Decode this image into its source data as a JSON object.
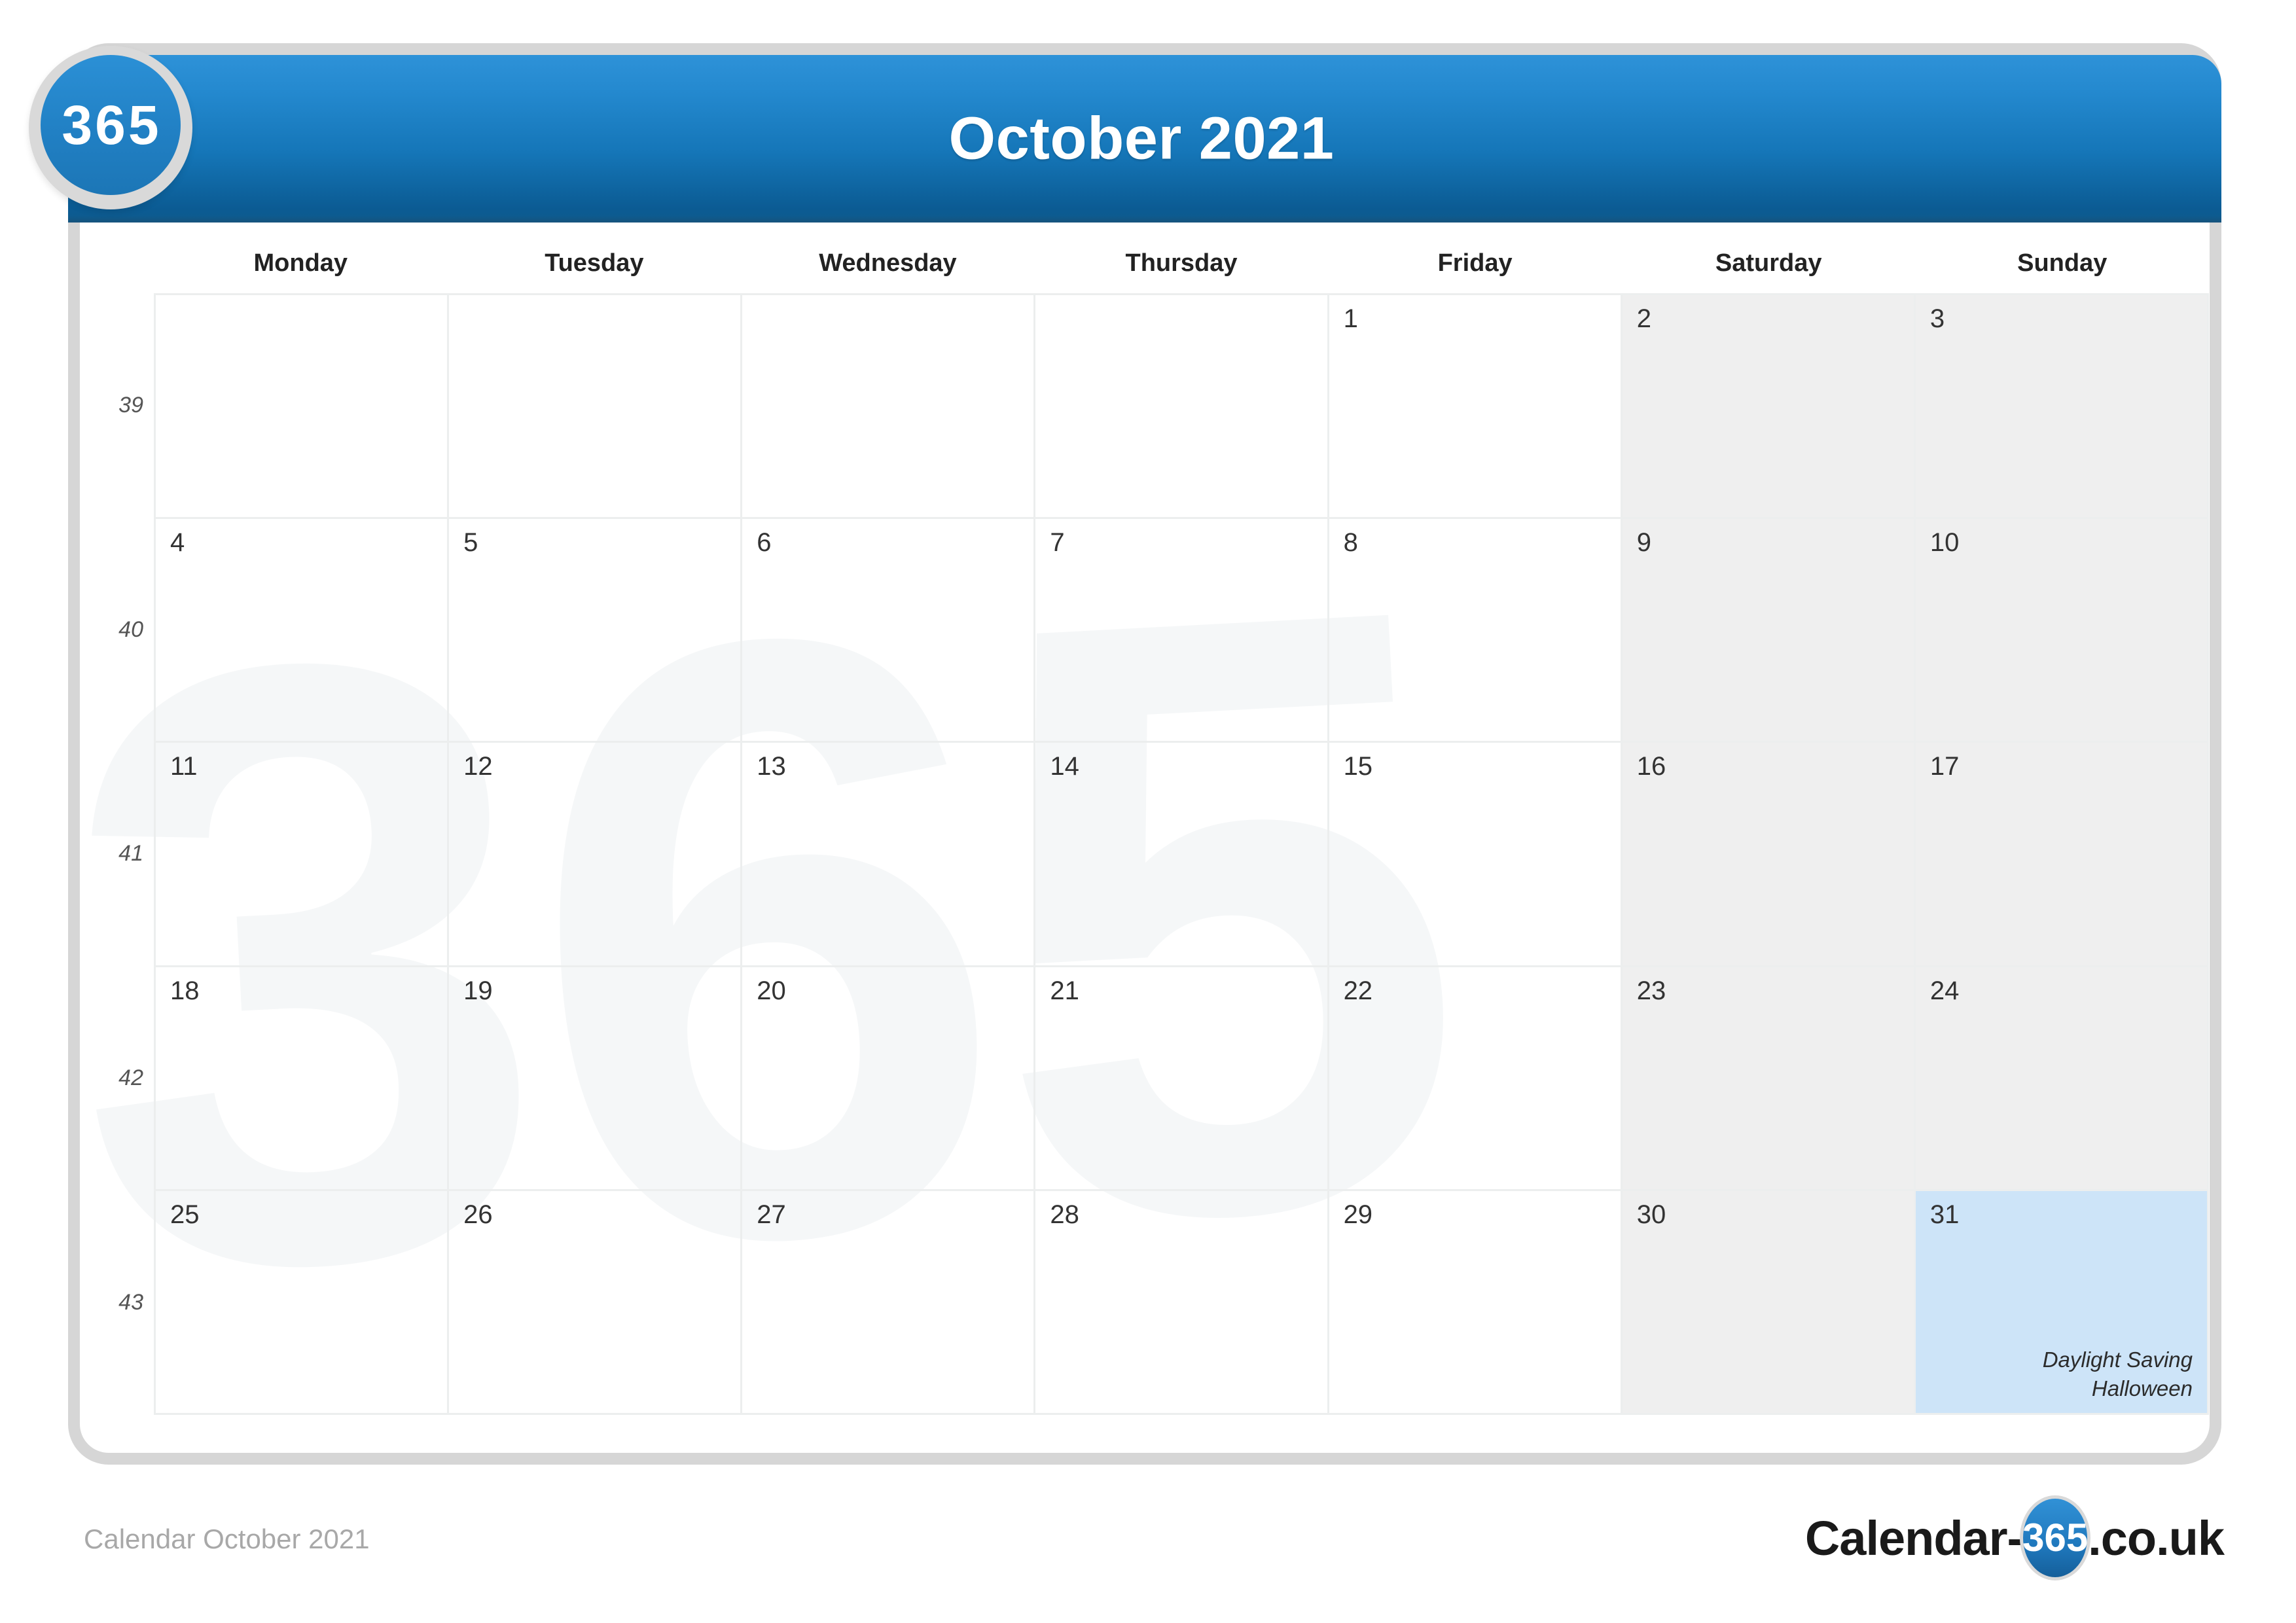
{
  "brand": {
    "badge_text": "365",
    "watermark_text": "365"
  },
  "header": {
    "title": "October 2021"
  },
  "weekdays": [
    {
      "label": "Monday"
    },
    {
      "label": "Tuesday"
    },
    {
      "label": "Wednesday"
    },
    {
      "label": "Thursday"
    },
    {
      "label": "Friday"
    },
    {
      "label": "Saturday"
    },
    {
      "label": "Sunday"
    }
  ],
  "week_numbers": [
    "39",
    "40",
    "41",
    "42",
    "43"
  ],
  "weeks": [
    {
      "week_number": "39",
      "days": [
        {
          "number": "",
          "weekend": false,
          "highlight": false,
          "events": []
        },
        {
          "number": "",
          "weekend": false,
          "highlight": false,
          "events": []
        },
        {
          "number": "",
          "weekend": false,
          "highlight": false,
          "events": []
        },
        {
          "number": "",
          "weekend": false,
          "highlight": false,
          "events": []
        },
        {
          "number": "1",
          "weekend": false,
          "highlight": false,
          "events": []
        },
        {
          "number": "2",
          "weekend": true,
          "highlight": false,
          "events": []
        },
        {
          "number": "3",
          "weekend": true,
          "highlight": false,
          "events": []
        }
      ]
    },
    {
      "week_number": "40",
      "days": [
        {
          "number": "4",
          "weekend": false,
          "highlight": false,
          "events": []
        },
        {
          "number": "5",
          "weekend": false,
          "highlight": false,
          "events": []
        },
        {
          "number": "6",
          "weekend": false,
          "highlight": false,
          "events": []
        },
        {
          "number": "7",
          "weekend": false,
          "highlight": false,
          "events": []
        },
        {
          "number": "8",
          "weekend": false,
          "highlight": false,
          "events": []
        },
        {
          "number": "9",
          "weekend": true,
          "highlight": false,
          "events": []
        },
        {
          "number": "10",
          "weekend": true,
          "highlight": false,
          "events": []
        }
      ]
    },
    {
      "week_number": "41",
      "days": [
        {
          "number": "11",
          "weekend": false,
          "highlight": false,
          "events": []
        },
        {
          "number": "12",
          "weekend": false,
          "highlight": false,
          "events": []
        },
        {
          "number": "13",
          "weekend": false,
          "highlight": false,
          "events": []
        },
        {
          "number": "14",
          "weekend": false,
          "highlight": false,
          "events": []
        },
        {
          "number": "15",
          "weekend": false,
          "highlight": false,
          "events": []
        },
        {
          "number": "16",
          "weekend": true,
          "highlight": false,
          "events": []
        },
        {
          "number": "17",
          "weekend": true,
          "highlight": false,
          "events": []
        }
      ]
    },
    {
      "week_number": "42",
      "days": [
        {
          "number": "18",
          "weekend": false,
          "highlight": false,
          "events": []
        },
        {
          "number": "19",
          "weekend": false,
          "highlight": false,
          "events": []
        },
        {
          "number": "20",
          "weekend": false,
          "highlight": false,
          "events": []
        },
        {
          "number": "21",
          "weekend": false,
          "highlight": false,
          "events": []
        },
        {
          "number": "22",
          "weekend": false,
          "highlight": false,
          "events": []
        },
        {
          "number": "23",
          "weekend": true,
          "highlight": false,
          "events": []
        },
        {
          "number": "24",
          "weekend": true,
          "highlight": false,
          "events": []
        }
      ]
    },
    {
      "week_number": "43",
      "days": [
        {
          "number": "25",
          "weekend": false,
          "highlight": false,
          "events": []
        },
        {
          "number": "26",
          "weekend": false,
          "highlight": false,
          "events": []
        },
        {
          "number": "27",
          "weekend": false,
          "highlight": false,
          "events": []
        },
        {
          "number": "28",
          "weekend": false,
          "highlight": false,
          "events": []
        },
        {
          "number": "29",
          "weekend": false,
          "highlight": false,
          "events": []
        },
        {
          "number": "30",
          "weekend": true,
          "highlight": false,
          "events": []
        },
        {
          "number": "31",
          "weekend": true,
          "highlight": true,
          "events": [
            "Daylight Saving",
            "Halloween"
          ]
        }
      ]
    }
  ],
  "footer": {
    "caption": "Calendar October 2021",
    "logo_left": "Calendar-",
    "logo_badge": "365",
    "logo_right": ".co.uk"
  },
  "colors": {
    "header_top": "#2e92d8",
    "header_bottom": "#0b5b93",
    "badge_blue": "#2180c4",
    "weekend_bg": "#efefef",
    "highlight_bg": "#cde4f8",
    "grid_line": "#eceeee",
    "shell_border": "#d6d6d6",
    "footer_caption": "#a8a8a8"
  }
}
